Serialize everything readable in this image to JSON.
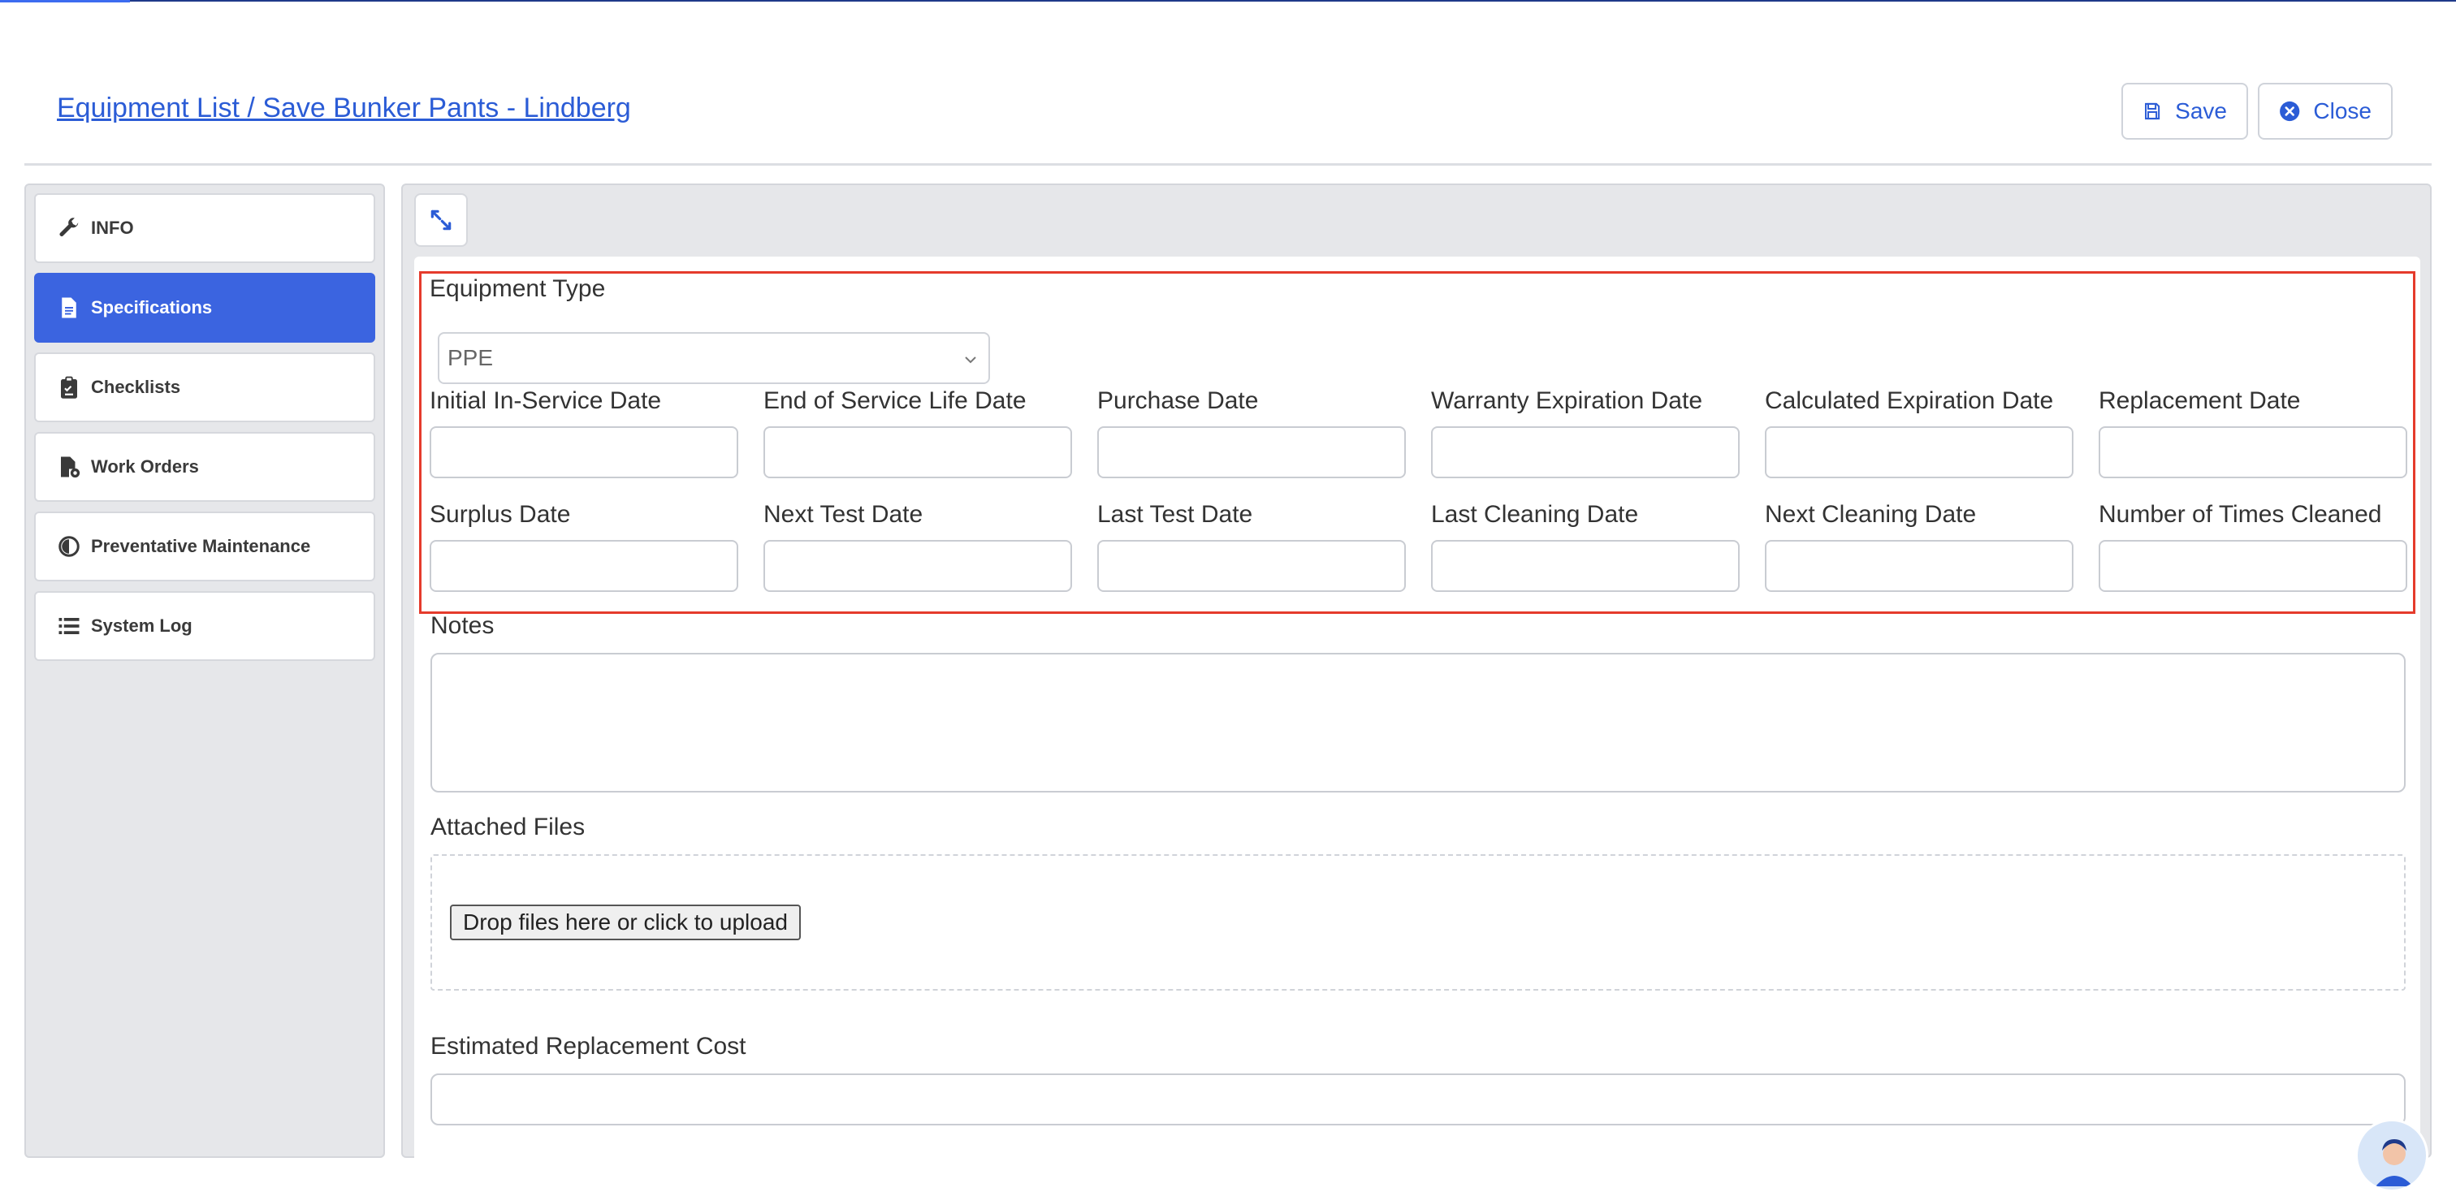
{
  "header": {
    "breadcrumb": "Equipment List / Save Bunker Pants - Lindberg",
    "save_label": "Save",
    "close_label": "Close"
  },
  "colors": {
    "accent": "#3b64e0",
    "link": "#2b5cd6",
    "highlight_border": "#e53b2c"
  },
  "sidebar": {
    "items": [
      {
        "label": "INFO",
        "icon": "wrench-icon"
      },
      {
        "label": "Specifications",
        "icon": "document-icon",
        "active": true
      },
      {
        "label": "Checklists",
        "icon": "clipboard-check-icon"
      },
      {
        "label": "Work Orders",
        "icon": "file-gear-icon"
      },
      {
        "label": "Preventative Maintenance",
        "icon": "half-circle-icon"
      },
      {
        "label": "System Log",
        "icon": "list-icon"
      }
    ]
  },
  "form": {
    "equipment_type_label": "Equipment Type",
    "equipment_type_value": "PPE",
    "row1": [
      "Initial In-Service Date",
      "End of Service Life Date",
      "Purchase Date",
      "Warranty Expiration Date",
      "Calculated Expiration Date",
      "Replacement Date"
    ],
    "row2": [
      "Surplus Date",
      "Next Test Date",
      "Last Test Date",
      "Last Cleaning Date",
      "Next Cleaning Date",
      "Number of Times Cleaned"
    ],
    "notes_label": "Notes",
    "attached_files_label": "Attached Files",
    "upload_button": "Drop files here or click to upload",
    "estimated_cost_label": "Estimated Replacement Cost"
  }
}
